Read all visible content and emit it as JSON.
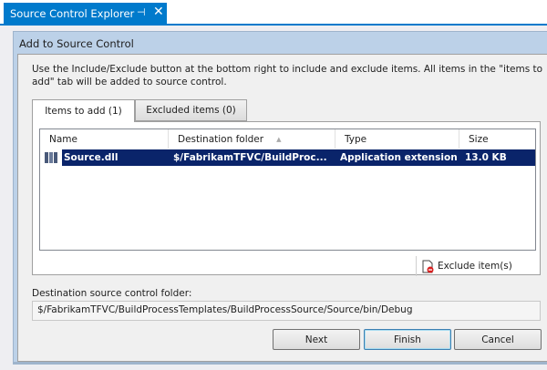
{
  "doc_tab": {
    "title": "Source Control Explorer",
    "pin": "⊣",
    "close": "✕"
  },
  "dialog": {
    "title": "Add to Source Control",
    "intro": "Use the Include/Exclude button at the bottom right to include and exclude items. All items in the \"items to add\" tab will be added to source control.",
    "tabs": [
      "Items to add (1)",
      "Excluded items (0)"
    ],
    "columns": [
      "Name",
      "Destination folder",
      "Type",
      "Size"
    ],
    "sort_indicator": "▲",
    "rows": [
      {
        "name": "Source.dll",
        "destination": "$/FabrikamTFVC/BuildProc...",
        "type": "Application extension",
        "size": "13.0 KB"
      }
    ],
    "exclude_label": "Exclude item(s)",
    "dest_label": "Destination source control folder:",
    "dest_value": "$/FabrikamTFVC/BuildProcessTemplates/BuildProcessSource/Source/bin/Debug",
    "buttons": {
      "next": "Next",
      "finish": "Finish",
      "cancel": "Cancel"
    }
  }
}
